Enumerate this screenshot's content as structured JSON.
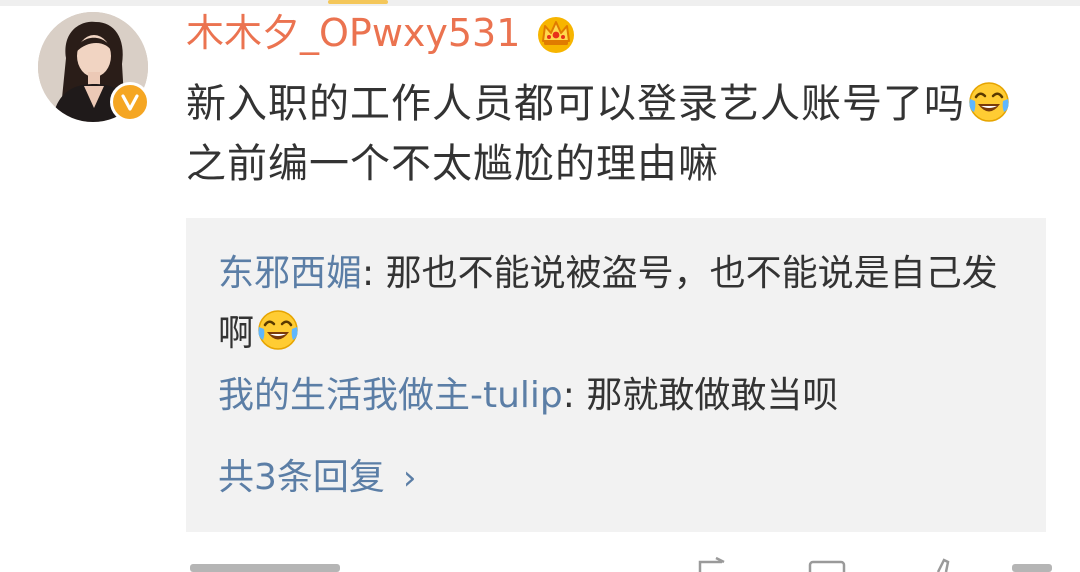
{
  "comment": {
    "username": "木木夕_OPwxy531",
    "text_before_emoji": "新入职的工作人员都可以登录艺人账号了吗",
    "text_after_emoji": "之前编一个不太尴尬的理由嘛",
    "emoji": "laugh-cry-emoji"
  },
  "replies": [
    {
      "author": "东邪西媚",
      "separator": ": ",
      "text": "那也不能说被盗号，也不能说是自己发啊",
      "emoji": "laugh-cry-emoji"
    },
    {
      "author": "我的生活我做主-tulip",
      "separator": ": ",
      "text": "那就敢做敢当呗"
    }
  ],
  "more_replies": {
    "label": "共3条回复",
    "chevron": "›"
  },
  "colors": {
    "username": "#eb7350",
    "link": "#5b7ea6",
    "text": "#333333",
    "reply_bg": "#f2f2f2",
    "badge": "#f5a623"
  },
  "icons": [
    "vip-crown-icon",
    "verified-badge-icon",
    "laugh-cry-emoji",
    "chevron-right-icon",
    "share-icon",
    "comment-icon",
    "like-icon"
  ]
}
